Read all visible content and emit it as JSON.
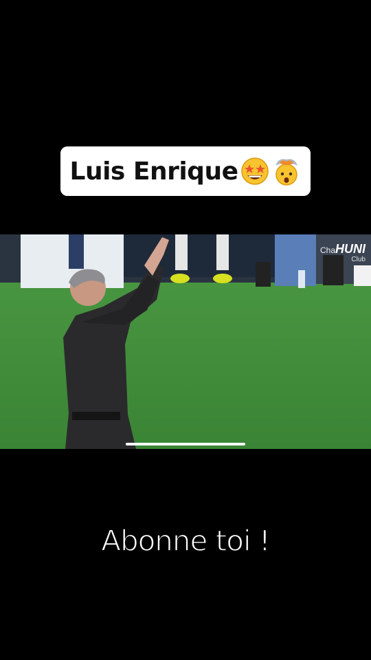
{
  "caption": {
    "text": "Luis Enrique",
    "emojis": [
      "star-struck-icon",
      "exploding-head-icon"
    ]
  },
  "video": {
    "watermark_small": "Cha",
    "watermark_brand": "HUNI",
    "watermark_sub": "Club",
    "playback_progress": 1.0
  },
  "overlay": {
    "text": "Abonne toi !"
  },
  "colors": {
    "background": "#000000",
    "pitch": "#3f8c3a",
    "caption_bg": "#ffffff"
  }
}
